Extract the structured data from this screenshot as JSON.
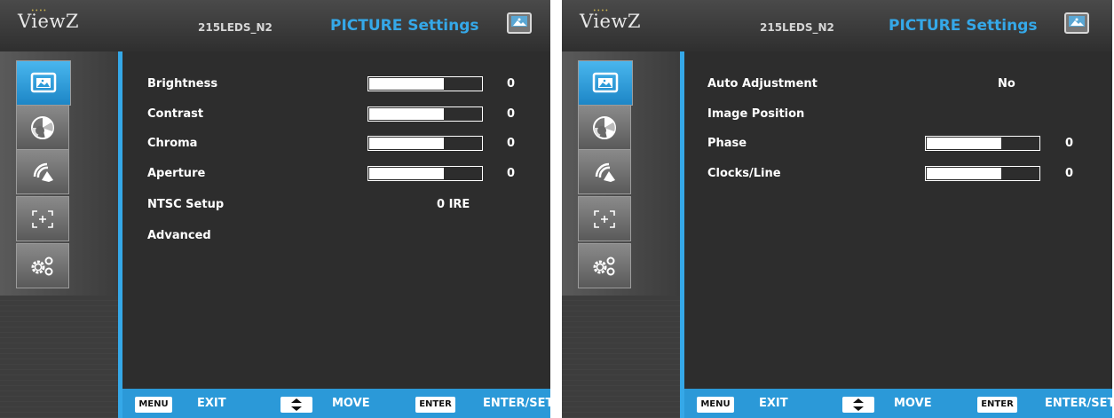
{
  "panels": {
    "left": {
      "logo": "ViewZ",
      "model": "215LEDS_N2",
      "title": "PICTURE Settings",
      "sidebar_tabs": [
        {
          "icon": "picture-icon",
          "active": true
        },
        {
          "icon": "color-wheel-icon",
          "active": false
        },
        {
          "icon": "signal-icon",
          "active": false
        },
        {
          "icon": "position-crosshair-icon",
          "active": false
        },
        {
          "icon": "gears-icon",
          "active": false
        }
      ],
      "rows": [
        {
          "label": "Brightness",
          "value": "0",
          "bar": true,
          "bar_fill": 0.66
        },
        {
          "label": "Contrast",
          "value": "0",
          "bar": true,
          "bar_fill": 0.66
        },
        {
          "label": "Chroma",
          "value": "0",
          "bar": true,
          "bar_fill": 0.66
        },
        {
          "label": "Aperture",
          "value": "0",
          "bar": true,
          "bar_fill": 0.66
        },
        {
          "label": "NTSC Setup",
          "value": "0 IRE",
          "bar": false
        },
        {
          "label": "Advanced",
          "value": "",
          "bar": false
        }
      ],
      "footer": {
        "menu_key": "MENU",
        "menu_action": "EXIT",
        "move_action": "MOVE",
        "enter_key": "ENTER",
        "enter_action": "ENTER/SET"
      }
    },
    "right": {
      "logo": "ViewZ",
      "model": "215LEDS_N2",
      "title": "PICTURE Settings",
      "sidebar_tabs": [
        {
          "icon": "picture-icon",
          "active": true
        },
        {
          "icon": "color-wheel-icon",
          "active": false
        },
        {
          "icon": "signal-icon",
          "active": false
        },
        {
          "icon": "position-crosshair-icon",
          "active": false
        },
        {
          "icon": "gears-icon",
          "active": false
        }
      ],
      "rows": [
        {
          "label": "Auto Adjustment",
          "value": "No",
          "bar": false
        },
        {
          "label": "Image Position",
          "value": "",
          "bar": false
        },
        {
          "label": "Phase",
          "value": "0",
          "bar": true,
          "bar_fill": 0.66
        },
        {
          "label": "Clocks/Line",
          "value": "0",
          "bar": true,
          "bar_fill": 0.66
        }
      ],
      "footer": {
        "menu_key": "MENU",
        "menu_action": "EXIT",
        "move_action": "MOVE",
        "enter_key": "ENTER",
        "enter_action": "ENTER/SET"
      }
    }
  },
  "colors": {
    "accent": "#35a8e8",
    "footer": "#2b99d8",
    "background": "#2d2d2d",
    "active_tab": "#2a9ad9"
  }
}
